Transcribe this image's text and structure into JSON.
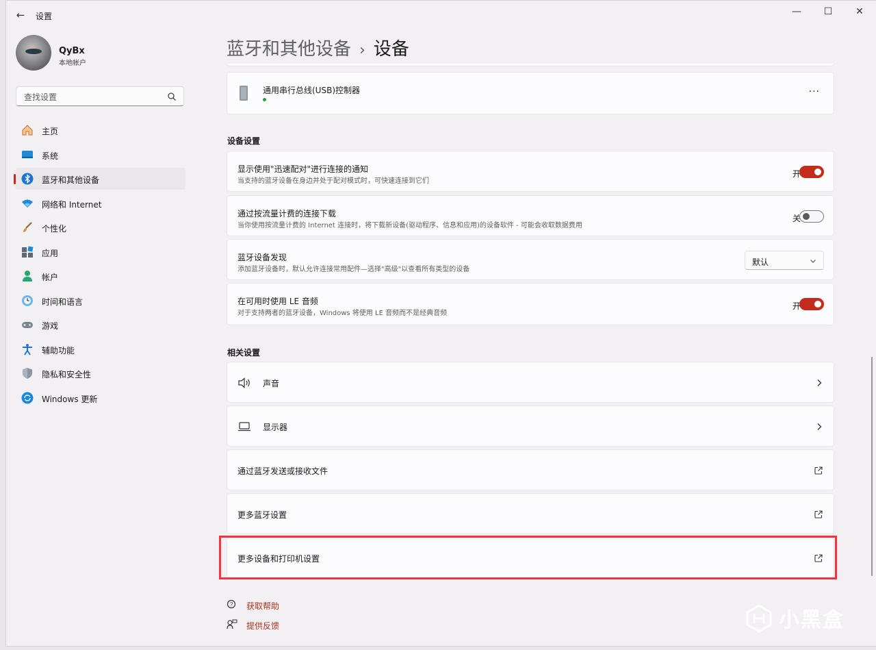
{
  "window": {
    "title": "设置",
    "back_glyph": "←",
    "minimize_glyph": "—",
    "maximize_glyph": "☐",
    "close_glyph": "✕"
  },
  "user": {
    "name": "QyBx",
    "account_type": "本地帐户"
  },
  "search": {
    "placeholder": "查找设置"
  },
  "sidebar": {
    "items": [
      {
        "label": "主页",
        "icon": "home-icon"
      },
      {
        "label": "系统",
        "icon": "system-icon"
      },
      {
        "label": "蓝牙和其他设备",
        "icon": "bluetooth-icon",
        "active": true
      },
      {
        "label": "网络和 Internet",
        "icon": "wifi-icon"
      },
      {
        "label": "个性化",
        "icon": "brush-icon"
      },
      {
        "label": "应用",
        "icon": "apps-icon"
      },
      {
        "label": "帐户",
        "icon": "account-icon"
      },
      {
        "label": "时间和语言",
        "icon": "time-language-icon"
      },
      {
        "label": "游戏",
        "icon": "gamepad-icon"
      },
      {
        "label": "辅助功能",
        "icon": "accessibility-icon"
      },
      {
        "label": "隐私和安全性",
        "icon": "shield-icon"
      },
      {
        "label": "Windows 更新",
        "icon": "update-icon"
      }
    ]
  },
  "breadcrumb": {
    "parent": "蓝牙和其他设备",
    "separator": "›",
    "current": "设备"
  },
  "device": {
    "name": "通用串行总线(USB)控制器",
    "more": "···"
  },
  "device_settings": {
    "title": "设备设置",
    "rows": [
      {
        "title": "显示使用\"迅速配对\"进行连接的通知",
        "desc": "当支持的蓝牙设备在身边并处于配对模式时，可快速连接到它们",
        "state": "开"
      },
      {
        "title": "通过按流量计费的连接下载",
        "desc": "当你使用按流量计费的 Internet 连接时，将下载新设备(驱动程序、信息和应用)的设备软件 - 可能会收取数据费用",
        "state": "关"
      },
      {
        "title": "蓝牙设备发现",
        "desc": "添加蓝牙设备时，默认允许连接常用配件—选择\"高级\"以查看所有类型的设备",
        "value": "默认"
      },
      {
        "title": "在可用时使用 LE 音频",
        "desc": "对于支持两者的蓝牙设备，Windows 将使用 LE 音频而不是经典音频",
        "state": "开"
      }
    ]
  },
  "related_settings": {
    "title": "相关设置",
    "items": [
      {
        "label": "声音"
      },
      {
        "label": "显示器"
      },
      {
        "label": "通过蓝牙发送或接收文件"
      },
      {
        "label": "更多蓝牙设置"
      },
      {
        "label": "更多设备和打印机设置"
      }
    ]
  },
  "help": {
    "get_help": "获取帮助",
    "feedback": "提供反馈"
  },
  "watermark": {
    "text": "小黑盒"
  },
  "colors": {
    "accent": "#c42b1c",
    "highlight_box": "#f0363c",
    "link": "#b0331c"
  }
}
